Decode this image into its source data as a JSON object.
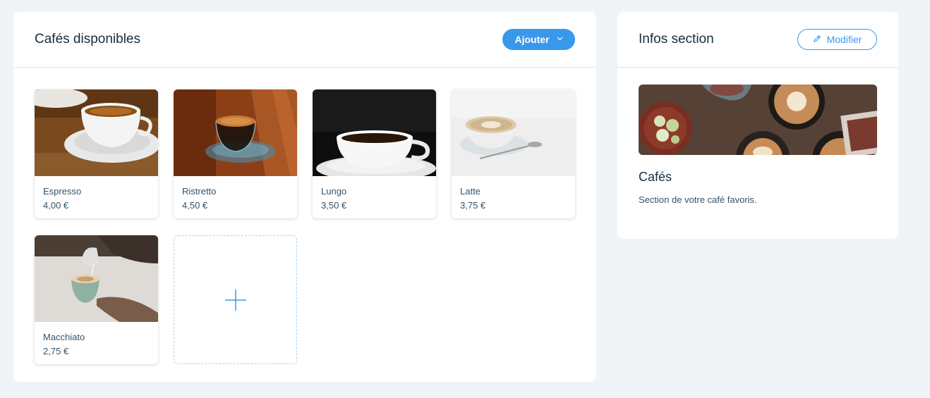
{
  "products_panel": {
    "title": "Cafés disponibles",
    "add_button_label": "Ajouter",
    "products": [
      {
        "name": "Espresso",
        "price": "4,00 €"
      },
      {
        "name": "Ristretto",
        "price": "4,50 €"
      },
      {
        "name": "Lungo",
        "price": "3,50 €"
      },
      {
        "name": "Latte",
        "price": "3,75 €"
      },
      {
        "name": "Macchiato",
        "price": "2,75 €"
      }
    ]
  },
  "info_panel": {
    "title": "Infos section",
    "edit_button_label": "Modifier",
    "section_name": "Cafés",
    "section_description": "Section de votre café favoris."
  },
  "colors": {
    "accent": "#3899ec",
    "background": "#f0f4f7",
    "text": "#162d3d"
  },
  "icons": [
    "chevron-down-icon",
    "pencil-icon",
    "plus-icon"
  ]
}
